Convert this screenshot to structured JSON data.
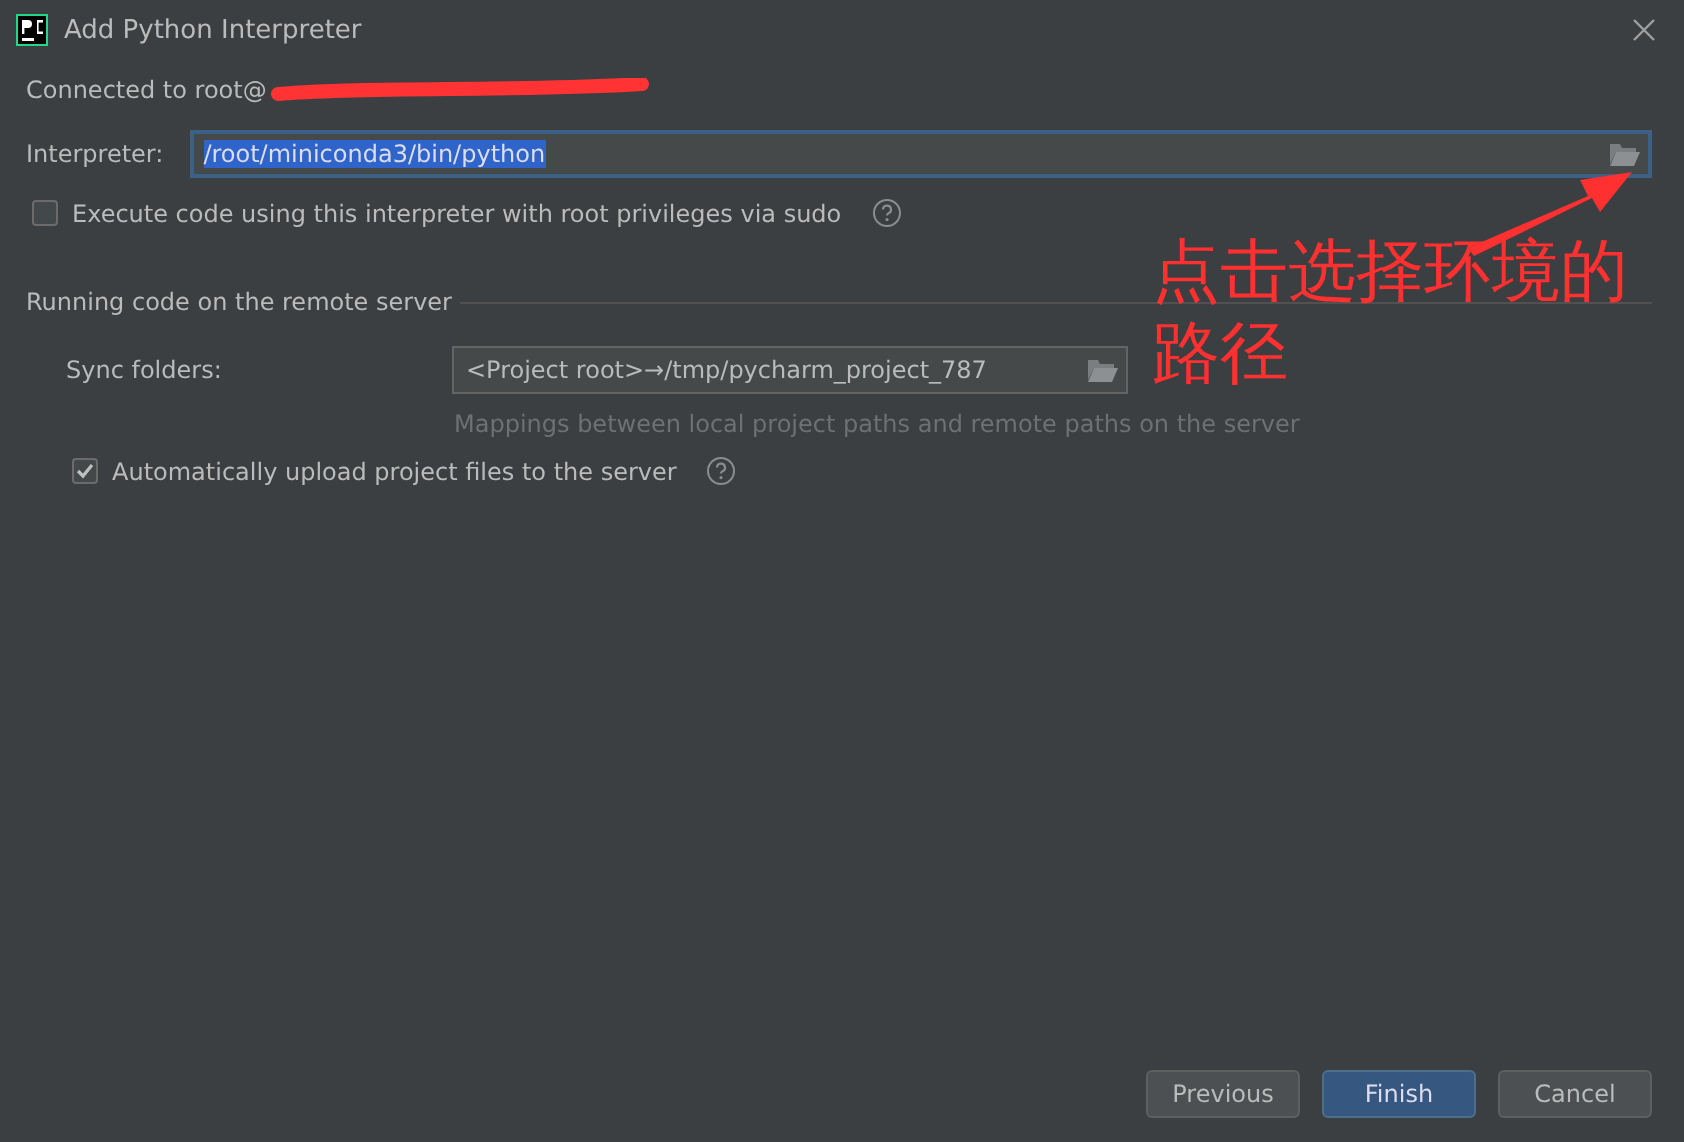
{
  "window": {
    "title": "Add Python Interpreter"
  },
  "connection": {
    "label": "Connected to root@",
    "redacted": true
  },
  "interpreter": {
    "label": "Interpreter:",
    "value": "/root/miniconda3/bin/python",
    "selected": true
  },
  "sudo": {
    "label": "Execute code using this interpreter with root privileges via sudo",
    "checked": false
  },
  "section": {
    "title": "Running code on the remote server"
  },
  "sync_folders": {
    "label": "Sync folders:",
    "value": "<Project root>→/tmp/pycharm_project_787",
    "hint": "Mappings between local project paths and remote paths on the server"
  },
  "auto_upload": {
    "label": "Automatically upload project files to the server",
    "checked": true
  },
  "annotation": {
    "text": "点击选择环境的路径"
  },
  "buttons": [
    {
      "label": "Previous",
      "default": false
    },
    {
      "label": "Finish",
      "default": true
    },
    {
      "label": "Cancel",
      "default": false
    }
  ]
}
